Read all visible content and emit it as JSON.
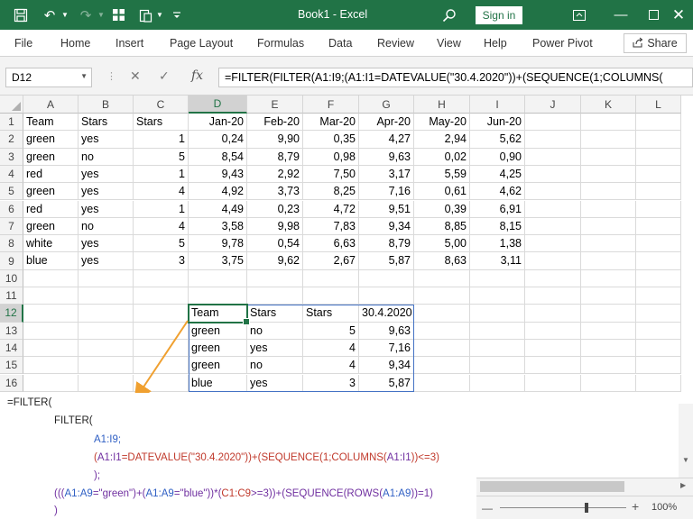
{
  "title_bar": {
    "title": "Book1  -  Excel",
    "sign_in": "Sign in"
  },
  "ribbon": {
    "tabs": [
      "File",
      "Home",
      "Insert",
      "Page Layout",
      "Formulas",
      "Data",
      "Review",
      "View",
      "Help",
      "Power Pivot"
    ],
    "share": "Share"
  },
  "formula_bar": {
    "name_box": "D12",
    "formula": "=FILTER(FILTER(A1:I9;(A1:I1=DATEVALUE(\"30.4.2020\"))+(SEQUENCE(1;COLUMNS("
  },
  "sheet": {
    "columns": [
      "A",
      "B",
      "C",
      "D",
      "E",
      "F",
      "G",
      "H",
      "I",
      "J",
      "K",
      "L"
    ],
    "rows": [
      "1",
      "2",
      "3",
      "4",
      "5",
      "6",
      "7",
      "8",
      "9",
      "10",
      "11",
      "12",
      "13",
      "14",
      "15",
      "16"
    ],
    "selected_column": "D",
    "selected_row": "12",
    "data": [
      [
        "Team",
        "Stars",
        "Stars",
        "Jan-20",
        "Feb-20",
        "Mar-20",
        "Apr-20",
        "May-20",
        "Jun-20"
      ],
      [
        "green",
        "yes",
        "1",
        "0,24",
        "9,90",
        "0,35",
        "4,27",
        "2,94",
        "5,62"
      ],
      [
        "green",
        "no",
        "5",
        "8,54",
        "8,79",
        "0,98",
        "9,63",
        "0,02",
        "0,90"
      ],
      [
        "red",
        "yes",
        "1",
        "9,43",
        "2,92",
        "7,50",
        "3,17",
        "5,59",
        "4,25"
      ],
      [
        "green",
        "yes",
        "4",
        "4,92",
        "3,73",
        "8,25",
        "7,16",
        "0,61",
        "4,62"
      ],
      [
        "red",
        "yes",
        "1",
        "4,49",
        "0,23",
        "4,72",
        "9,51",
        "0,39",
        "6,91"
      ],
      [
        "green",
        "no",
        "4",
        "3,58",
        "9,98",
        "7,83",
        "9,34",
        "8,85",
        "8,15"
      ],
      [
        "white",
        "yes",
        "5",
        "9,78",
        "0,54",
        "6,63",
        "8,79",
        "5,00",
        "1,38"
      ],
      [
        "blue",
        "yes",
        "3",
        "3,75",
        "9,62",
        "2,67",
        "5,87",
        "8,63",
        "3,11"
      ]
    ],
    "result": [
      [
        "Team",
        "Stars",
        "Stars",
        "30.4.2020"
      ],
      [
        "green",
        "no",
        "5",
        "9,63"
      ],
      [
        "green",
        "yes",
        "4",
        "7,16"
      ],
      [
        "green",
        "no",
        "4",
        "9,34"
      ],
      [
        "blue",
        "yes",
        "3",
        "5,87"
      ]
    ]
  },
  "explanation": {
    "l1": "=FILTER(",
    "l2": "FILTER(",
    "l3": "A1:I9;",
    "l4_a": "(",
    "l4_r1": "A1:I1",
    "l4_b": "=DATEVALUE(\"30.4.2020\"))+(SEQUENCE(1;COLUMNS(",
    "l4_r2": "A1:I1",
    "l4_c": "))<=3)",
    "l5": ");",
    "l6_a": "(((",
    "l6_r1": "A1:A9",
    "l6_b": "=\"green\")+(",
    "l6_r2": "A1:A9",
    "l6_c": "=\"blue\"))*(",
    "l6_r3": "C1:C9",
    "l6_d": ">=3))+(SEQUENCE(ROWS(",
    "l6_r4": "A1:A9",
    "l6_e": "))=1)",
    "l7": ")"
  },
  "status": {
    "zoom": "100%"
  },
  "colors": {
    "excel_green": "#217346",
    "spill_blue": "#4472c4",
    "arrow_orange": "#f0a030"
  }
}
